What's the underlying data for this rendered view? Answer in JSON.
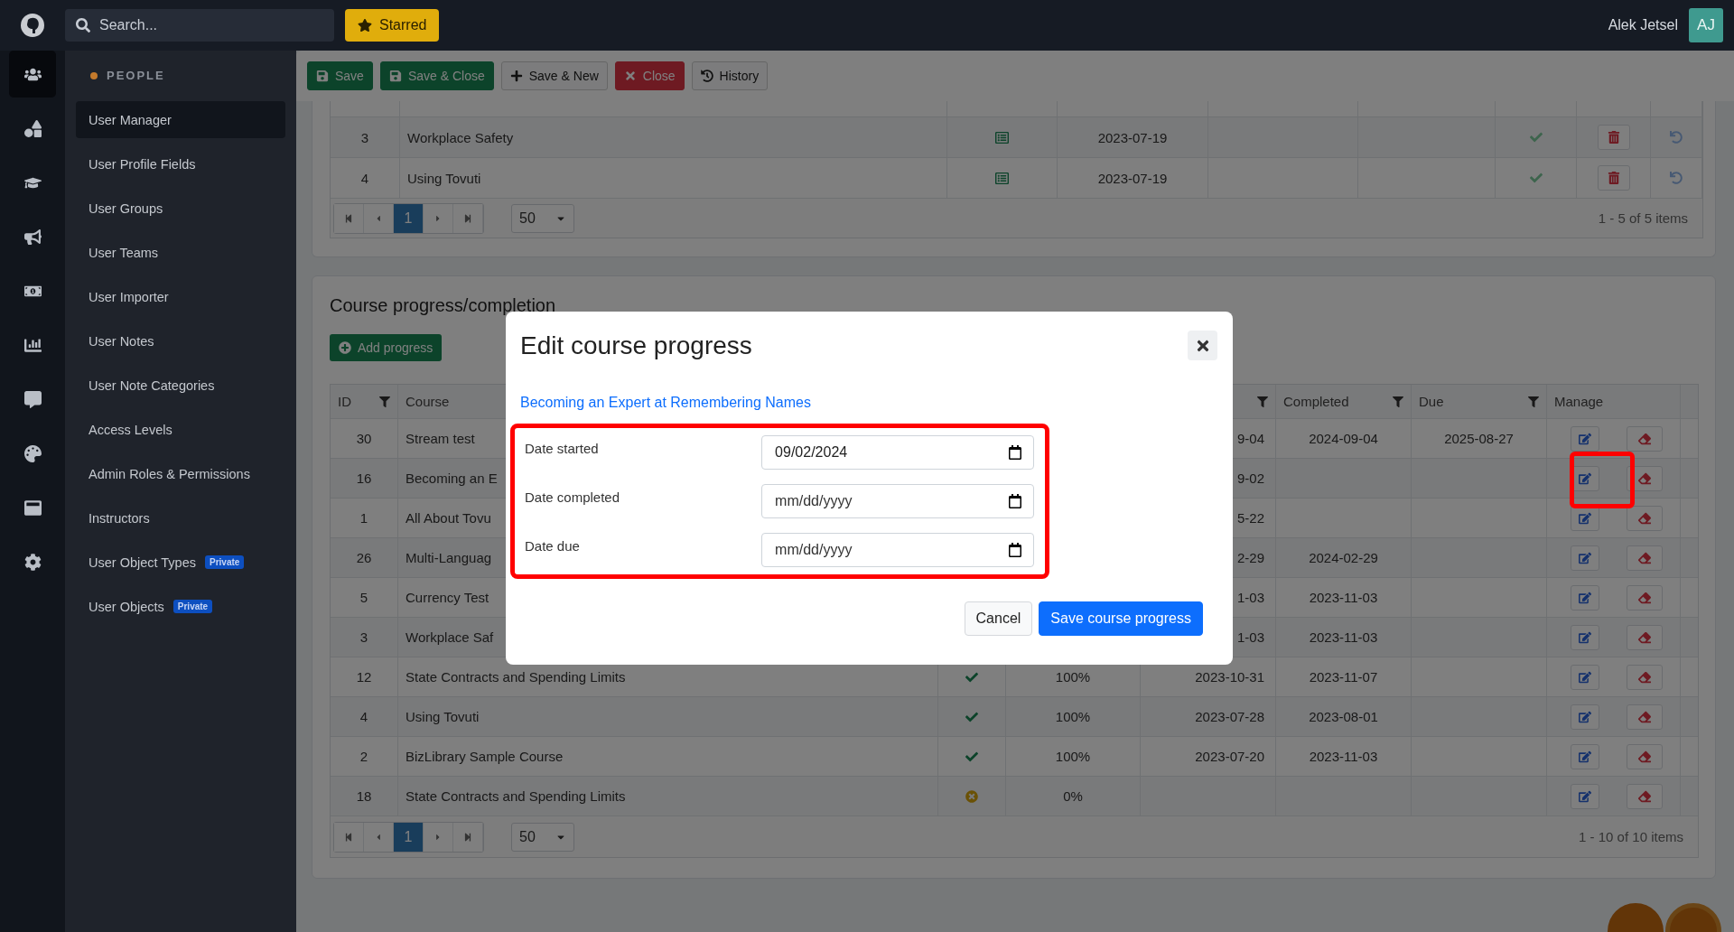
{
  "topbar": {
    "search_placeholder": "Search...",
    "starred": "Starred",
    "user_name": "Alek Jetsel",
    "avatar_initials": "AJ"
  },
  "rail": [
    {
      "kind": "users",
      "selected": true
    },
    {
      "kind": "shapes",
      "selected": false
    },
    {
      "kind": "cap",
      "selected": false
    },
    {
      "kind": "megaphone",
      "selected": false
    },
    {
      "kind": "money",
      "selected": false
    },
    {
      "kind": "chart",
      "selected": false
    },
    {
      "kind": "comment",
      "selected": false
    },
    {
      "kind": "palette",
      "selected": false
    },
    {
      "kind": "window",
      "selected": false
    },
    {
      "kind": "gear",
      "selected": false
    }
  ],
  "sidebar": {
    "section": "PEOPLE",
    "items": [
      {
        "label": "User Manager",
        "selected": true
      },
      {
        "label": "User Profile Fields",
        "selected": false
      },
      {
        "label": "User Groups",
        "selected": false
      },
      {
        "label": "User Teams",
        "selected": false
      },
      {
        "label": "User Importer",
        "selected": false
      },
      {
        "label": "User Notes",
        "selected": false
      },
      {
        "label": "User Note Categories",
        "selected": false
      },
      {
        "label": "Access Levels",
        "selected": false
      },
      {
        "label": "Admin Roles & Permissions",
        "selected": false
      },
      {
        "label": "Instructors",
        "selected": false
      },
      {
        "label": "User Object Types",
        "selected": false,
        "badge": "Private"
      },
      {
        "label": "User Objects",
        "selected": false,
        "badge": "Private"
      }
    ]
  },
  "toolbar": [
    {
      "label": "Save",
      "kind": "save"
    },
    {
      "label": "Save & Close",
      "kind": "save"
    },
    {
      "label": "Save & New",
      "kind": "new"
    },
    {
      "label": "Close",
      "kind": "close"
    },
    {
      "label": "History",
      "kind": "history"
    }
  ],
  "upper_table": {
    "rows": [
      {
        "id": "3",
        "title": "Workplace Safety",
        "date": "2023-07-19"
      },
      {
        "id": "4",
        "title": "Using Tovuti",
        "date": "2023-07-19"
      }
    ],
    "pager": {
      "page": "1",
      "page_size": "50",
      "summary": "1 - 5 of 5 items"
    }
  },
  "progress": {
    "title": "Course progress/completion",
    "add_button": "Add progress",
    "columns": [
      {
        "label": "ID",
        "filter": true
      },
      {
        "label": "Course",
        "filter": false
      },
      {
        "filter": true
      },
      {
        "label": "Completed",
        "filter": true
      },
      {
        "label": "Due",
        "filter": true
      },
      {
        "label": "Manage",
        "filter": false
      }
    ],
    "rows": [
      {
        "id": "30",
        "course": "Stream test",
        "started": "9-04",
        "completed": "2024-09-04",
        "due": "2025-08-27"
      },
      {
        "id": "16",
        "course": "Becoming an E",
        "started": "9-02",
        "highlighted": true
      },
      {
        "id": "1",
        "course": "All About Tovu",
        "started": "5-22"
      },
      {
        "id": "26",
        "course": "Multi-Languag",
        "started": "2-29",
        "completed": "2024-02-29"
      },
      {
        "id": "5",
        "course": "Currency Test",
        "started": "1-03",
        "completed": "2023-11-03"
      },
      {
        "id": "3",
        "course": "Workplace Saf",
        "started": "1-03",
        "completed": "2023-11-03"
      },
      {
        "id": "12",
        "course": "State Contracts and Spending Limits",
        "kind": "done",
        "percent": "100%",
        "started": "2023-10-31",
        "completed": "2023-11-07"
      },
      {
        "id": "4",
        "course": "Using Tovuti",
        "kind": "done",
        "percent": "100%",
        "started": "2023-07-28",
        "completed": "2023-08-01"
      },
      {
        "id": "2",
        "course": "BizLibrary Sample Course",
        "kind": "done",
        "percent": "100%",
        "started": "2023-07-20",
        "completed": "2023-11-03"
      },
      {
        "id": "18",
        "course": "State Contracts and Spending Limits",
        "kind": "failed",
        "percent": "0%"
      }
    ],
    "pager": {
      "page": "1",
      "page_size": "50",
      "summary": "1 - 10 of 10 items"
    }
  },
  "modal": {
    "title": "Edit course progress",
    "course_link": "Becoming an Expert at Remembering Names",
    "highlighted": true,
    "fields": [
      {
        "label": "Date started",
        "value": "09/02/2024"
      },
      {
        "label": "Date completed",
        "placeholder": "mm/dd/yyyy"
      },
      {
        "label": "Date due",
        "placeholder": "mm/dd/yyyy"
      }
    ],
    "buttons": [
      {
        "label": "Cancel",
        "kind": "secondary"
      },
      {
        "label": "Save course progress",
        "kind": "primary"
      }
    ]
  }
}
